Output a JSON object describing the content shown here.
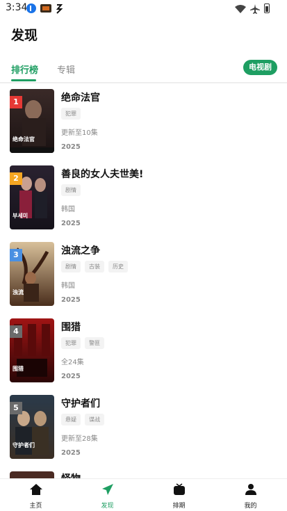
{
  "status_bar": {
    "time": "3:34",
    "icons": [
      "download-icon",
      "app-icon",
      "app-icon",
      "wifi-icon",
      "airplane-icon",
      "battery-icon"
    ]
  },
  "page_title": "发现",
  "tabs": [
    {
      "label": "排行榜",
      "active": true
    },
    {
      "label": "专辑",
      "active": false
    }
  ],
  "category_chip": {
    "label": "电视剧",
    "color": "#1e9e62"
  },
  "items": [
    {
      "rank": "1",
      "rank_color": "#e53935",
      "title": "绝命法官",
      "tags": [
        "犯罪"
      ],
      "meta": "更新至10集",
      "year": "2025",
      "poster_caption": "绝命法官",
      "poster_colors": [
        "#2b1f1f",
        "#6b3d2a"
      ]
    },
    {
      "rank": "2",
      "rank_color": "#f5a623",
      "title": "善良的女人夫世美!",
      "tags": [
        "剧情"
      ],
      "meta": "韩国",
      "year": "2025",
      "poster_caption": "부세미",
      "poster_colors": [
        "#1c1c2a",
        "#7a1f3a"
      ]
    },
    {
      "rank": "3",
      "rank_color": "#4a90e2",
      "title": "浊流之争",
      "tags": [
        "剧情",
        "古装",
        "历史"
      ],
      "meta": "韩国",
      "year": "2025",
      "poster_caption": "浊流",
      "poster_colors": [
        "#c9a56a",
        "#5b3a22"
      ]
    },
    {
      "rank": "4",
      "rank_color": "#6b6b6b",
      "title": "围猎",
      "tags": [
        "犯罪",
        "警匪"
      ],
      "meta": "全24集",
      "year": "2025",
      "poster_caption": "围猎",
      "poster_colors": [
        "#8a0f0f",
        "#2a0505"
      ]
    },
    {
      "rank": "5",
      "rank_color": "#6b6b6b",
      "title": "守护者们",
      "tags": [
        "悬疑",
        "谍战"
      ],
      "meta": "更新至28集",
      "year": "2025",
      "poster_caption": "守护者们",
      "poster_colors": [
        "#1a2a3a",
        "#6a5a4a"
      ]
    }
  ],
  "partial_item": {
    "title": "怪物"
  },
  "bottom_nav": [
    {
      "label": "主页",
      "icon": "home-icon",
      "active": false
    },
    {
      "label": "发现",
      "icon": "send-icon",
      "active": true
    },
    {
      "label": "排期",
      "icon": "tv-icon",
      "active": false
    },
    {
      "label": "我的",
      "icon": "person-icon",
      "active": false
    }
  ],
  "colors": {
    "accent": "#1e9e62",
    "text": "#111111",
    "muted": "#888888"
  }
}
